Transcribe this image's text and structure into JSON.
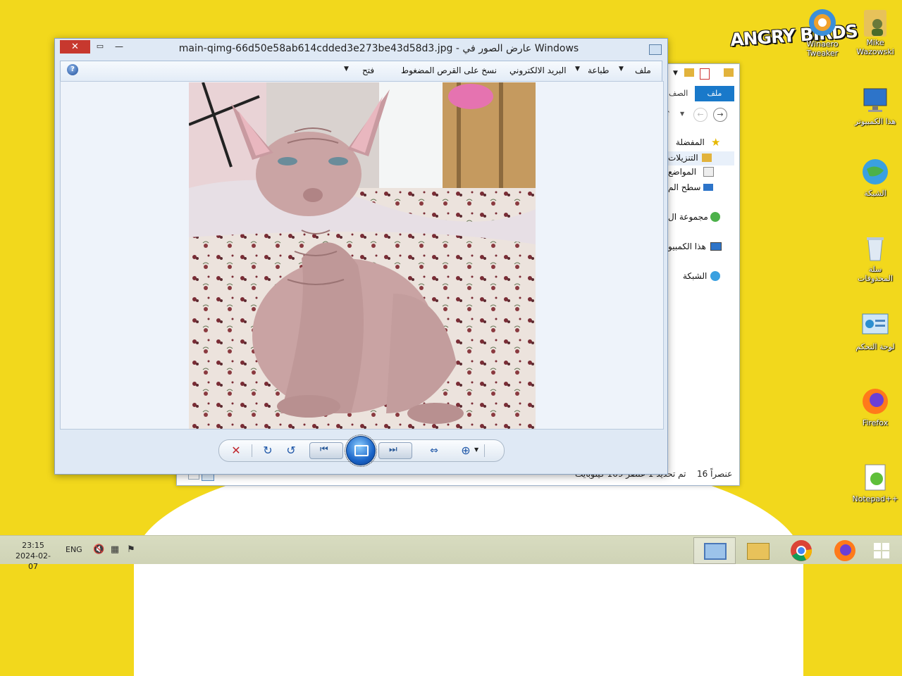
{
  "desktop": {
    "angry_birds_logo": "ANGRY BIRDS",
    "icons": [
      {
        "id": "winaero",
        "label": "Winaero Tweaker"
      },
      {
        "id": "mike",
        "label": "Mike Wazowski"
      },
      {
        "id": "this_pc",
        "label": "هذا الكمبيوتر"
      },
      {
        "id": "network",
        "label": "الشبكة"
      },
      {
        "id": "recycle",
        "label": "سلة المحذوفات"
      },
      {
        "id": "control_panel",
        "label": "لوحة التحكم"
      },
      {
        "id": "firefox",
        "label": "Firefox"
      },
      {
        "id": "notepadpp",
        "label": "Notepad++"
      }
    ]
  },
  "explorer": {
    "tab_file": "ملف",
    "tab_home": "الصف",
    "tree": {
      "favorites": "المفضلة",
      "downloads": "التنزيلات",
      "recent": "المواضع",
      "desktop": "سطح الم",
      "homegroup": "مجموعة ال",
      "this_pc": "هذا الكمبيو",
      "network": "الشبكة"
    },
    "status_items": "16 عنصراً",
    "status_selected": "تم تحديد 1 عنصر 169 كيلوبايت"
  },
  "viewer": {
    "title": "main-qimg-66d50e58ab614cdded3e273be43d58d3.jpg - عارض الصور في Windows",
    "menu": {
      "file": "ملف",
      "print": "طباعة",
      "email": "البريد الالكتروني",
      "burn": "نسخ على القرص المضغوط",
      "open": "فتح"
    },
    "photo_alt": "Hairless sphynx cat sitting on floral bedding"
  },
  "taskbar": {
    "time": "23:15",
    "date": "2024-02-07",
    "lang": "ENG"
  },
  "colors": {
    "wallpaper": "#f2d81c",
    "accent": "#1979ca",
    "close": "#c7382e"
  }
}
